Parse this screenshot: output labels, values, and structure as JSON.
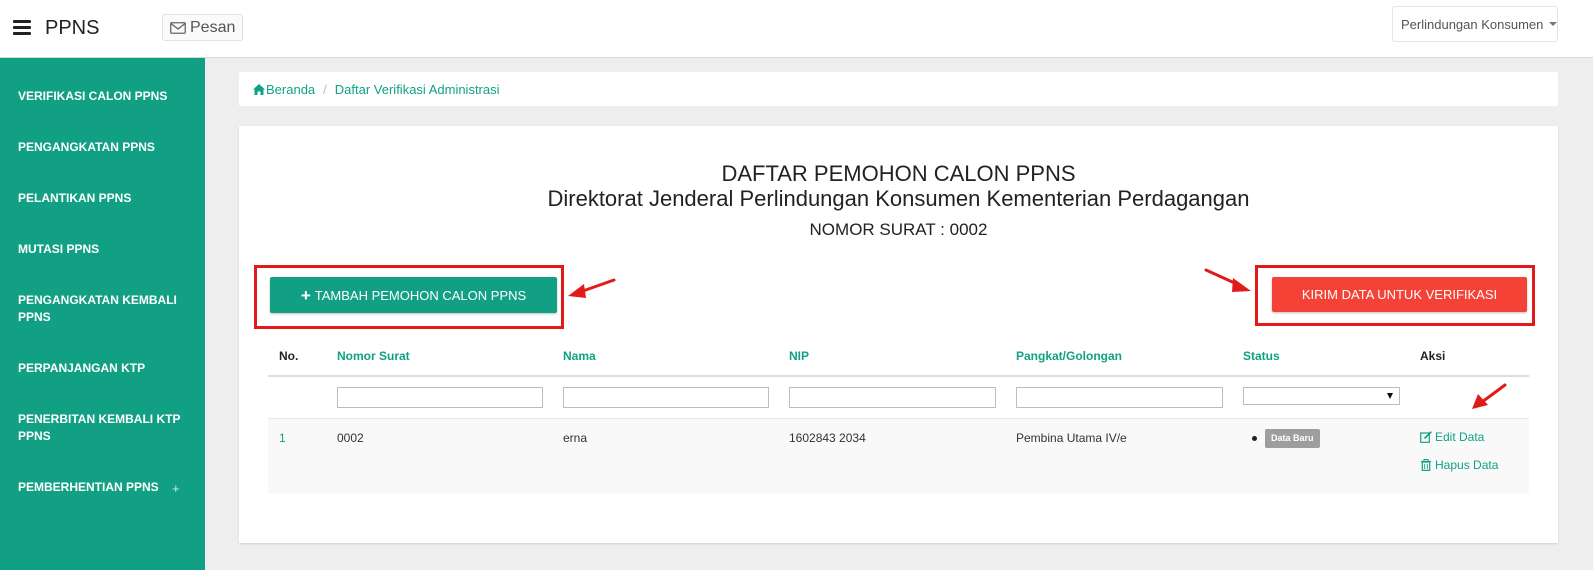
{
  "header": {
    "brand": "PPNS",
    "pesan_label": "Pesan",
    "user_menu": "Perlindungan Konsumen"
  },
  "sidebar": {
    "items": [
      {
        "label": "VERIFIKASI CALON PPNS"
      },
      {
        "label": "PENGANGKATAN PPNS"
      },
      {
        "label": "PELANTIKAN PPNS"
      },
      {
        "label": "MUTASI PPNS"
      },
      {
        "label": "PENGANGKATAN KEMBALI PPNS"
      },
      {
        "label": "PERPANJANGAN KTP"
      },
      {
        "label": "PENERBITAN KEMBALI KTP PPNS"
      },
      {
        "label": "PEMBERHENTIAN PPNS"
      }
    ],
    "expand_symbol": "+"
  },
  "breadcrumb": {
    "home": "Beranda",
    "separator": "/",
    "current": "Daftar Verifikasi Administrasi"
  },
  "main": {
    "title": "DAFTAR PEMOHON CALON PPNS",
    "subtitle": "Direktorat Jenderal Perlindungan Konsumen Kementerian Perdagangan",
    "nomor_surat": "NOMOR SURAT : 0002",
    "add_button": "TAMBAH PEMOHON CALON PPNS",
    "send_button": "KIRIM DATA UNTUK VERIFIKASI"
  },
  "table": {
    "columns": [
      "No.",
      "Nomor Surat",
      "Nama",
      "NIP",
      "Pangkat/Golongan",
      "Status",
      "Aksi"
    ],
    "rows": [
      {
        "no": "1",
        "nomor_surat": "0002",
        "nama": "erna",
        "nip": "1602843 2034",
        "pangkat": "Pembina Utama IV/e",
        "status": "Data Baru",
        "actions": [
          "Edit Data",
          "Hapus Data"
        ]
      }
    ]
  },
  "colors": {
    "primary": "#12a085",
    "danger": "#f44336",
    "highlight": "#e11a1a",
    "badge": "#9e9e9e"
  }
}
